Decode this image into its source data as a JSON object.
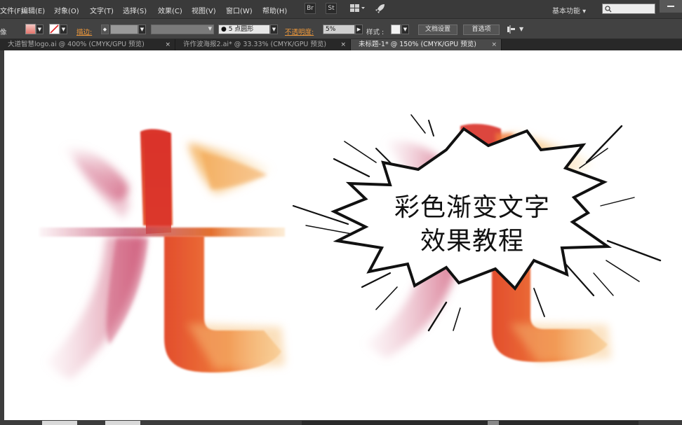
{
  "menubar": {
    "items": [
      "文件(F)",
      "编辑(E)",
      "对象(O)",
      "文字(T)",
      "选择(S)",
      "效果(C)",
      "视图(V)",
      "窗口(W)",
      "帮助(H)"
    ],
    "toolbar_icons": [
      "Br",
      "St",
      "arrange-documents-icon",
      "rocket-icon"
    ],
    "workspace": "基本功能",
    "search_placeholder": ""
  },
  "controlbar": {
    "mode_label": "像",
    "stroke_label": "描边",
    "brush_value": "5 点圆形",
    "opacity_label": "不透明度",
    "opacity_value": "5%",
    "style_label": "样式",
    "doc_setup_button": "文档设置",
    "preferences_button": "首选项"
  },
  "tabs": [
    {
      "label": "大道智慧logo.ai @ 400% (CMYK/GPU 预览)",
      "active": false
    },
    {
      "label": "许作波海报2.ai* @ 33.33% (CMYK/GPU 预览)",
      "active": false
    },
    {
      "label": "未标题-1* @ 150% (CMYK/GPU 预览)",
      "active": true
    }
  ],
  "tab_close_glyph": "×",
  "canvas": {
    "artwork_glyph": "光",
    "speech_bubble_lines": [
      "彩色渐变文字",
      "效果教程"
    ]
  },
  "colors": {
    "red": "#d9332a",
    "orange": "#ef7b3a",
    "amber": "#f3a94e",
    "pink": "#c9476a"
  }
}
